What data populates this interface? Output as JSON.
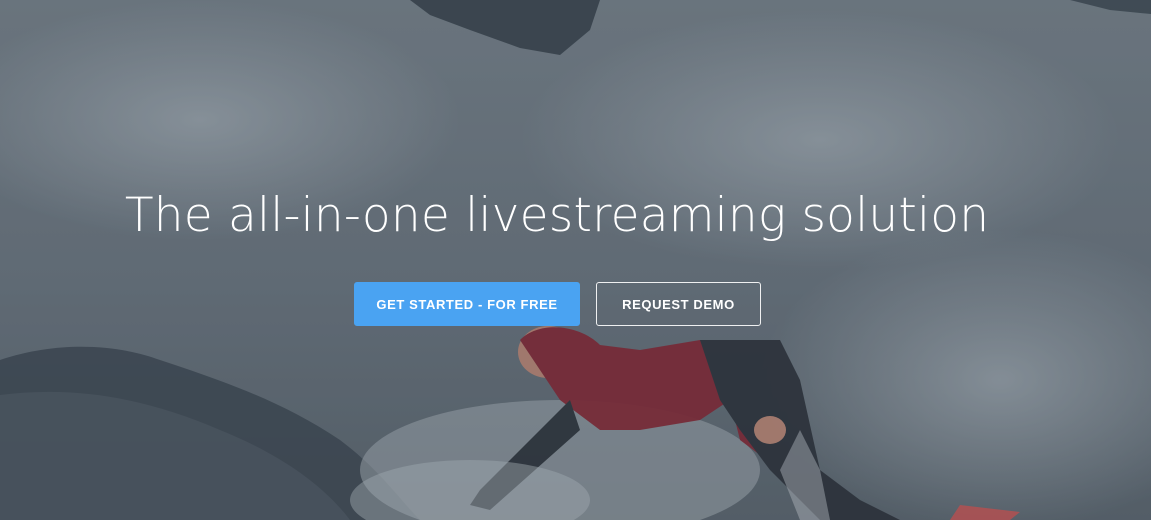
{
  "hero": {
    "headline": "The all-in-one livestreaming solution",
    "primary_cta": "GET STARTED - FOR FREE",
    "secondary_cta": "REQUEST DEMO",
    "background": "surfer-riding-wave-video"
  },
  "colors": {
    "primary_button": "#4aa3f2",
    "text": "#ffffff",
    "overlay": "#28343e"
  }
}
